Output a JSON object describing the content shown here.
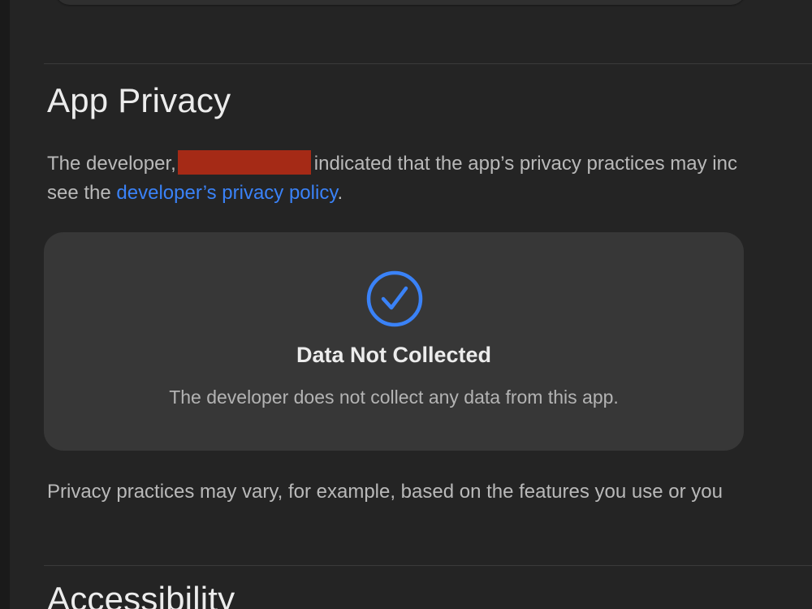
{
  "privacy": {
    "title": "App Privacy",
    "intro_prefix": "The developer,",
    "intro_suffix": "indicated that the app’s privacy practices may inc",
    "intro_line2_prefix": "see the",
    "policy_link": "developer’s privacy policy",
    "intro_line2_suffix": ".",
    "card": {
      "icon": "checkmark-circle-icon",
      "title": "Data Not Collected",
      "subtitle": "The developer does not collect any data from this app."
    },
    "note": "Privacy practices may vary, for example, based on the features you use or you"
  },
  "accessibility": {
    "title": "Accessibility"
  },
  "colors": {
    "background": "#242424",
    "card": "#373737",
    "accent": "#3a82f7",
    "redaction": "#a52a16"
  }
}
